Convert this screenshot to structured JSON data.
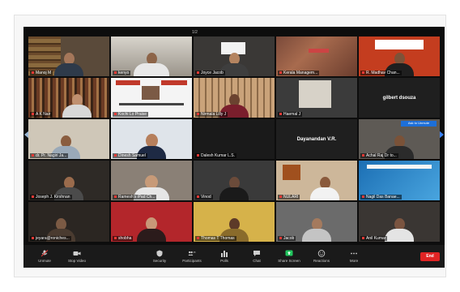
{
  "tiles": [
    {
      "name": "Manoj M",
      "scene": "shelf"
    },
    {
      "name": "kenyo",
      "scene": "room",
      "active": true
    },
    {
      "name": "Joyce Jacob",
      "scene": "wall"
    },
    {
      "name": "Kerala Managem...",
      "scene": "art"
    },
    {
      "name": "R. Madhav Chan...",
      "scene": "banner"
    },
    {
      "name": "A K Nair",
      "scene": "books"
    },
    {
      "name": "Kochi Lo Praise",
      "scene": "slide"
    },
    {
      "name": "Nirmala Lilly J",
      "scene": "shelf2"
    },
    {
      "name": "Haemal J",
      "scene": "plain"
    },
    {
      "name": "gilbert dsouza",
      "scene": "textonly"
    },
    {
      "name": "dr. Pr. Nagiri Ja...",
      "scene": "wall2"
    },
    {
      "name": "Dinesh Samuel",
      "scene": "portrait"
    },
    {
      "name": "Dalesh Kumar L.S.",
      "scene": "dark"
    },
    {
      "name": "Dayanandan V.R.",
      "scene": "textonly2"
    },
    {
      "name": "Achal Raj Dr to...",
      "scene": "spotlight"
    },
    {
      "name": "Joseph J. Kirshnan",
      "scene": "dark2"
    },
    {
      "name": "Ramesh's iPad Ch...",
      "scene": "room2"
    },
    {
      "name": "Vinod",
      "scene": "dark3"
    },
    {
      "name": "NULARI",
      "scene": "room3"
    },
    {
      "name": "Nagil Das Banae...",
      "scene": "blue"
    },
    {
      "name": "jeyara@roniches...",
      "scene": "dark4"
    },
    {
      "name": "shobha",
      "scene": "red"
    },
    {
      "name": "Thomas T Thomas",
      "scene": "yellow"
    },
    {
      "name": "Jacob",
      "scene": "room4"
    },
    {
      "name": "Anil Kumar",
      "scene": "room5"
    }
  ],
  "center_labels": {
    "tile_9": "gilbert dsouza",
    "tile_13": "Dayanandan V.R."
  },
  "spotlight_badge": "Ask to Unmute",
  "page_indicator": "1/2",
  "toolbar": {
    "unmute": "Unmute",
    "stop_video": "Stop Video",
    "security": "Security",
    "participants": "Participants",
    "participants_count": "25",
    "polls": "Polls",
    "chat": "Chat",
    "share_screen": "Share Screen",
    "reactions": "Reactions",
    "more": "More",
    "end": "End"
  },
  "colors": {
    "active_speaker": "#b6d600",
    "end_button": "#e02424",
    "share_icon": "#22c55e"
  }
}
